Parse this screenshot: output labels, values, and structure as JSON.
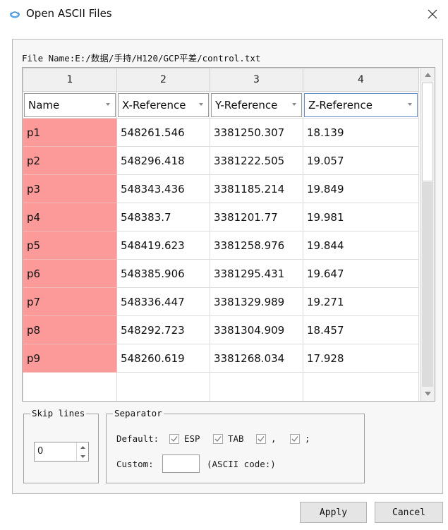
{
  "window": {
    "title": "Open ASCII Files",
    "app_icon": "app-logo-icon",
    "close_icon": "close-icon"
  },
  "file_name": "File Name:E:/数据/手持/H120/GCP平差/control.txt",
  "grid": {
    "column_numbers": [
      "1",
      "2",
      "3",
      "4"
    ],
    "column_headers": [
      "Name",
      "X-Reference",
      "Y-Reference",
      "Z-Reference"
    ],
    "rows": [
      [
        "p1",
        "548261.546",
        "3381250.307",
        "18.139"
      ],
      [
        "p2",
        "548296.418",
        "3381222.505",
        "19.057"
      ],
      [
        "p3",
        "548343.436",
        "3381185.214",
        "19.849"
      ],
      [
        "p4",
        "548383.7",
        "3381201.77",
        "19.981"
      ],
      [
        "p5",
        "548419.623",
        "3381258.976",
        "19.844"
      ],
      [
        "p6",
        "548385.906",
        "3381295.431",
        "19.647"
      ],
      [
        "p7",
        "548336.447",
        "3381329.989",
        "19.271"
      ],
      [
        "p8",
        "548292.723",
        "3381304.909",
        "18.457"
      ],
      [
        "p9",
        "548260.619",
        "3381268.034",
        "17.928"
      ]
    ],
    "name_column_color": "#fc9a9a"
  },
  "skip_lines": {
    "title": "Skip lines",
    "value": "0"
  },
  "separator": {
    "title": "Separator",
    "default_label": "Default:",
    "options": [
      {
        "label": "ESP",
        "checked": true
      },
      {
        "label": "TAB",
        "checked": true
      },
      {
        "label": ",",
        "checked": true
      },
      {
        "label": ";",
        "checked": true
      }
    ],
    "custom_label": "Custom:",
    "custom_value": "",
    "ascii_code_label": "(ASCII code:)"
  },
  "buttons": {
    "apply": "Apply",
    "cancel": "Cancel"
  }
}
